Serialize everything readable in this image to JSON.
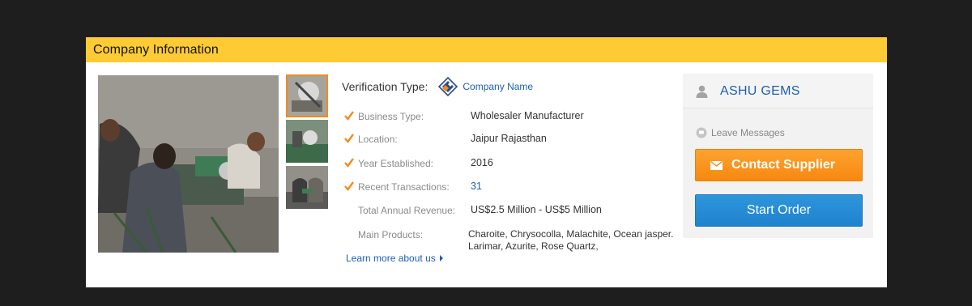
{
  "header": {
    "title": "Company Information"
  },
  "verification": {
    "label": "Verification Type:",
    "value": "Company Name",
    "icon": "verified-company-icon"
  },
  "details": [
    {
      "key": "Business Type:",
      "value": "Wholesaler Manufacturer",
      "checked": true
    },
    {
      "key": "Location:",
      "value": "Jaipur Rajasthan",
      "checked": true
    },
    {
      "key": "Year Established:",
      "value": "2016",
      "checked": true
    },
    {
      "key": "Recent Transactions:",
      "value": "31",
      "checked": true
    },
    {
      "key": "Total Annual Revenue:",
      "value": "US$2.5 Million - US$5 Million",
      "checked": false
    },
    {
      "key": "Main Products:",
      "value": "Charoite, Chrysocolla, Malachite, Ocean jasper. Larimar, Azurite, Rose Quartz,",
      "checked": false
    }
  ],
  "learn_more": "Learn more about us",
  "side": {
    "company_name": "ASHU GEMS",
    "leave_messages": "Leave Messages",
    "contact_button": "Contact Supplier",
    "order_button": "Start Order"
  },
  "colors": {
    "accent": "#fecb34",
    "link": "#1d5fb3",
    "contact": "#f7880f",
    "order": "#1f82cd",
    "check": "#f08c1e"
  }
}
